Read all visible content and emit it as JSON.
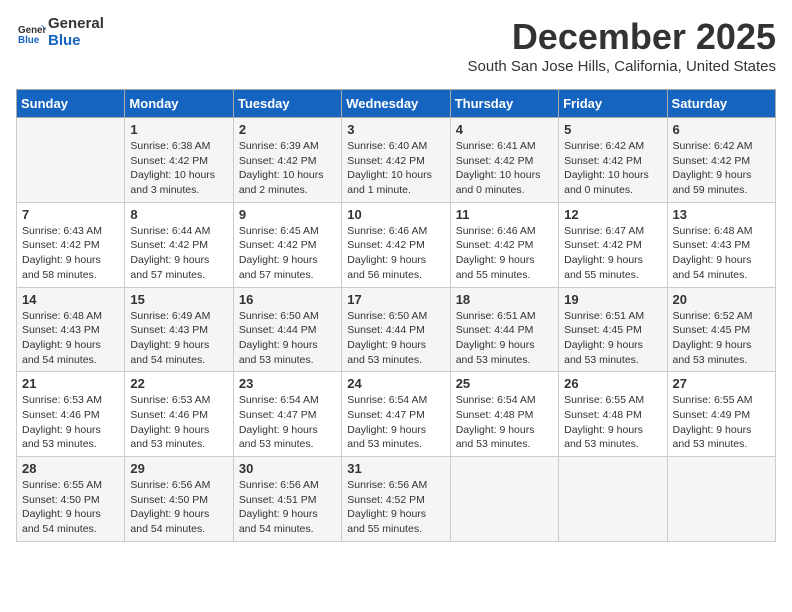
{
  "header": {
    "logo_general": "General",
    "logo_blue": "Blue",
    "month_title": "December 2025",
    "location": "South San Jose Hills, California, United States"
  },
  "days_of_week": [
    "Sunday",
    "Monday",
    "Tuesday",
    "Wednesday",
    "Thursday",
    "Friday",
    "Saturday"
  ],
  "weeks": [
    [
      {
        "day": "",
        "sunrise": "",
        "sunset": "",
        "daylight": ""
      },
      {
        "day": "1",
        "sunrise": "Sunrise: 6:38 AM",
        "sunset": "Sunset: 4:42 PM",
        "daylight": "Daylight: 10 hours and 3 minutes."
      },
      {
        "day": "2",
        "sunrise": "Sunrise: 6:39 AM",
        "sunset": "Sunset: 4:42 PM",
        "daylight": "Daylight: 10 hours and 2 minutes."
      },
      {
        "day": "3",
        "sunrise": "Sunrise: 6:40 AM",
        "sunset": "Sunset: 4:42 PM",
        "daylight": "Daylight: 10 hours and 1 minute."
      },
      {
        "day": "4",
        "sunrise": "Sunrise: 6:41 AM",
        "sunset": "Sunset: 4:42 PM",
        "daylight": "Daylight: 10 hours and 0 minutes."
      },
      {
        "day": "5",
        "sunrise": "Sunrise: 6:42 AM",
        "sunset": "Sunset: 4:42 PM",
        "daylight": "Daylight: 10 hours and 0 minutes."
      },
      {
        "day": "6",
        "sunrise": "Sunrise: 6:42 AM",
        "sunset": "Sunset: 4:42 PM",
        "daylight": "Daylight: 9 hours and 59 minutes."
      }
    ],
    [
      {
        "day": "7",
        "sunrise": "Sunrise: 6:43 AM",
        "sunset": "Sunset: 4:42 PM",
        "daylight": "Daylight: 9 hours and 58 minutes."
      },
      {
        "day": "8",
        "sunrise": "Sunrise: 6:44 AM",
        "sunset": "Sunset: 4:42 PM",
        "daylight": "Daylight: 9 hours and 57 minutes."
      },
      {
        "day": "9",
        "sunrise": "Sunrise: 6:45 AM",
        "sunset": "Sunset: 4:42 PM",
        "daylight": "Daylight: 9 hours and 57 minutes."
      },
      {
        "day": "10",
        "sunrise": "Sunrise: 6:46 AM",
        "sunset": "Sunset: 4:42 PM",
        "daylight": "Daylight: 9 hours and 56 minutes."
      },
      {
        "day": "11",
        "sunrise": "Sunrise: 6:46 AM",
        "sunset": "Sunset: 4:42 PM",
        "daylight": "Daylight: 9 hours and 55 minutes."
      },
      {
        "day": "12",
        "sunrise": "Sunrise: 6:47 AM",
        "sunset": "Sunset: 4:42 PM",
        "daylight": "Daylight: 9 hours and 55 minutes."
      },
      {
        "day": "13",
        "sunrise": "Sunrise: 6:48 AM",
        "sunset": "Sunset: 4:43 PM",
        "daylight": "Daylight: 9 hours and 54 minutes."
      }
    ],
    [
      {
        "day": "14",
        "sunrise": "Sunrise: 6:48 AM",
        "sunset": "Sunset: 4:43 PM",
        "daylight": "Daylight: 9 hours and 54 minutes."
      },
      {
        "day": "15",
        "sunrise": "Sunrise: 6:49 AM",
        "sunset": "Sunset: 4:43 PM",
        "daylight": "Daylight: 9 hours and 54 minutes."
      },
      {
        "day": "16",
        "sunrise": "Sunrise: 6:50 AM",
        "sunset": "Sunset: 4:44 PM",
        "daylight": "Daylight: 9 hours and 53 minutes."
      },
      {
        "day": "17",
        "sunrise": "Sunrise: 6:50 AM",
        "sunset": "Sunset: 4:44 PM",
        "daylight": "Daylight: 9 hours and 53 minutes."
      },
      {
        "day": "18",
        "sunrise": "Sunrise: 6:51 AM",
        "sunset": "Sunset: 4:44 PM",
        "daylight": "Daylight: 9 hours and 53 minutes."
      },
      {
        "day": "19",
        "sunrise": "Sunrise: 6:51 AM",
        "sunset": "Sunset: 4:45 PM",
        "daylight": "Daylight: 9 hours and 53 minutes."
      },
      {
        "day": "20",
        "sunrise": "Sunrise: 6:52 AM",
        "sunset": "Sunset: 4:45 PM",
        "daylight": "Daylight: 9 hours and 53 minutes."
      }
    ],
    [
      {
        "day": "21",
        "sunrise": "Sunrise: 6:53 AM",
        "sunset": "Sunset: 4:46 PM",
        "daylight": "Daylight: 9 hours and 53 minutes."
      },
      {
        "day": "22",
        "sunrise": "Sunrise: 6:53 AM",
        "sunset": "Sunset: 4:46 PM",
        "daylight": "Daylight: 9 hours and 53 minutes."
      },
      {
        "day": "23",
        "sunrise": "Sunrise: 6:54 AM",
        "sunset": "Sunset: 4:47 PM",
        "daylight": "Daylight: 9 hours and 53 minutes."
      },
      {
        "day": "24",
        "sunrise": "Sunrise: 6:54 AM",
        "sunset": "Sunset: 4:47 PM",
        "daylight": "Daylight: 9 hours and 53 minutes."
      },
      {
        "day": "25",
        "sunrise": "Sunrise: 6:54 AM",
        "sunset": "Sunset: 4:48 PM",
        "daylight": "Daylight: 9 hours and 53 minutes."
      },
      {
        "day": "26",
        "sunrise": "Sunrise: 6:55 AM",
        "sunset": "Sunset: 4:48 PM",
        "daylight": "Daylight: 9 hours and 53 minutes."
      },
      {
        "day": "27",
        "sunrise": "Sunrise: 6:55 AM",
        "sunset": "Sunset: 4:49 PM",
        "daylight": "Daylight: 9 hours and 53 minutes."
      }
    ],
    [
      {
        "day": "28",
        "sunrise": "Sunrise: 6:55 AM",
        "sunset": "Sunset: 4:50 PM",
        "daylight": "Daylight: 9 hours and 54 minutes."
      },
      {
        "day": "29",
        "sunrise": "Sunrise: 6:56 AM",
        "sunset": "Sunset: 4:50 PM",
        "daylight": "Daylight: 9 hours and 54 minutes."
      },
      {
        "day": "30",
        "sunrise": "Sunrise: 6:56 AM",
        "sunset": "Sunset: 4:51 PM",
        "daylight": "Daylight: 9 hours and 54 minutes."
      },
      {
        "day": "31",
        "sunrise": "Sunrise: 6:56 AM",
        "sunset": "Sunset: 4:52 PM",
        "daylight": "Daylight: 9 hours and 55 minutes."
      },
      {
        "day": "",
        "sunrise": "",
        "sunset": "",
        "daylight": ""
      },
      {
        "day": "",
        "sunrise": "",
        "sunset": "",
        "daylight": ""
      },
      {
        "day": "",
        "sunrise": "",
        "sunset": "",
        "daylight": ""
      }
    ]
  ]
}
